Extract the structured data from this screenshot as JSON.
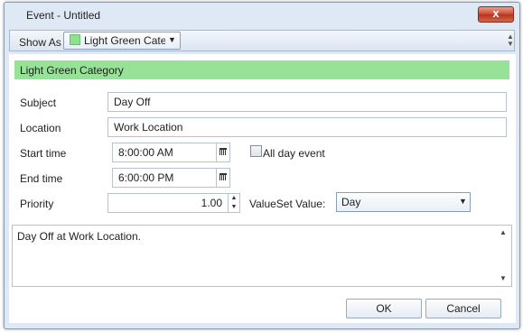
{
  "window": {
    "title": "Event - Untitled",
    "close_glyph": "x"
  },
  "toolbar": {
    "show_as_label": "Show As",
    "show_as_value": "Light Green Category",
    "show_as_color": "#8fe08f",
    "dropdown_arrow": "▼"
  },
  "category": {
    "label": "Light Green Category",
    "color": "#96e296"
  },
  "form": {
    "subject_label": "Subject",
    "subject_value": "Day Off",
    "location_label": "Location",
    "location_value": "Work Location",
    "start_label": "Start time",
    "start_value": "8:00:00 AM",
    "end_label": "End time",
    "end_value": "6:00:00 PM",
    "all_day_label": "All day event",
    "all_day_checked": false,
    "priority_label": "Priority",
    "priority_value": "1.00",
    "valueset_label": "ValueSet Value:",
    "valueset_value": "Day"
  },
  "description": {
    "text": "Day Off at Work Location."
  },
  "buttons": {
    "ok": "OK",
    "cancel": "Cancel"
  }
}
